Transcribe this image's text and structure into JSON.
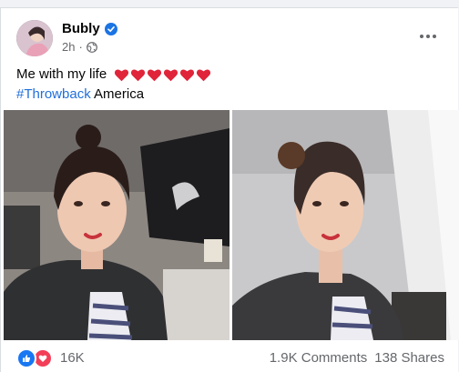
{
  "post": {
    "author": "Bubly",
    "time": "2h",
    "separator": "·",
    "text": "Me with my life",
    "hashtag": "#Throwback",
    "location_text": "America",
    "heart_count": 6
  },
  "footer": {
    "reactions": "16K",
    "comments": "1.9K Comments",
    "shares": "138 Shares"
  },
  "colors": {
    "verified": "#1b74e4",
    "link": "#216fdb",
    "like": "#1877f2",
    "love": "#f33e58"
  }
}
